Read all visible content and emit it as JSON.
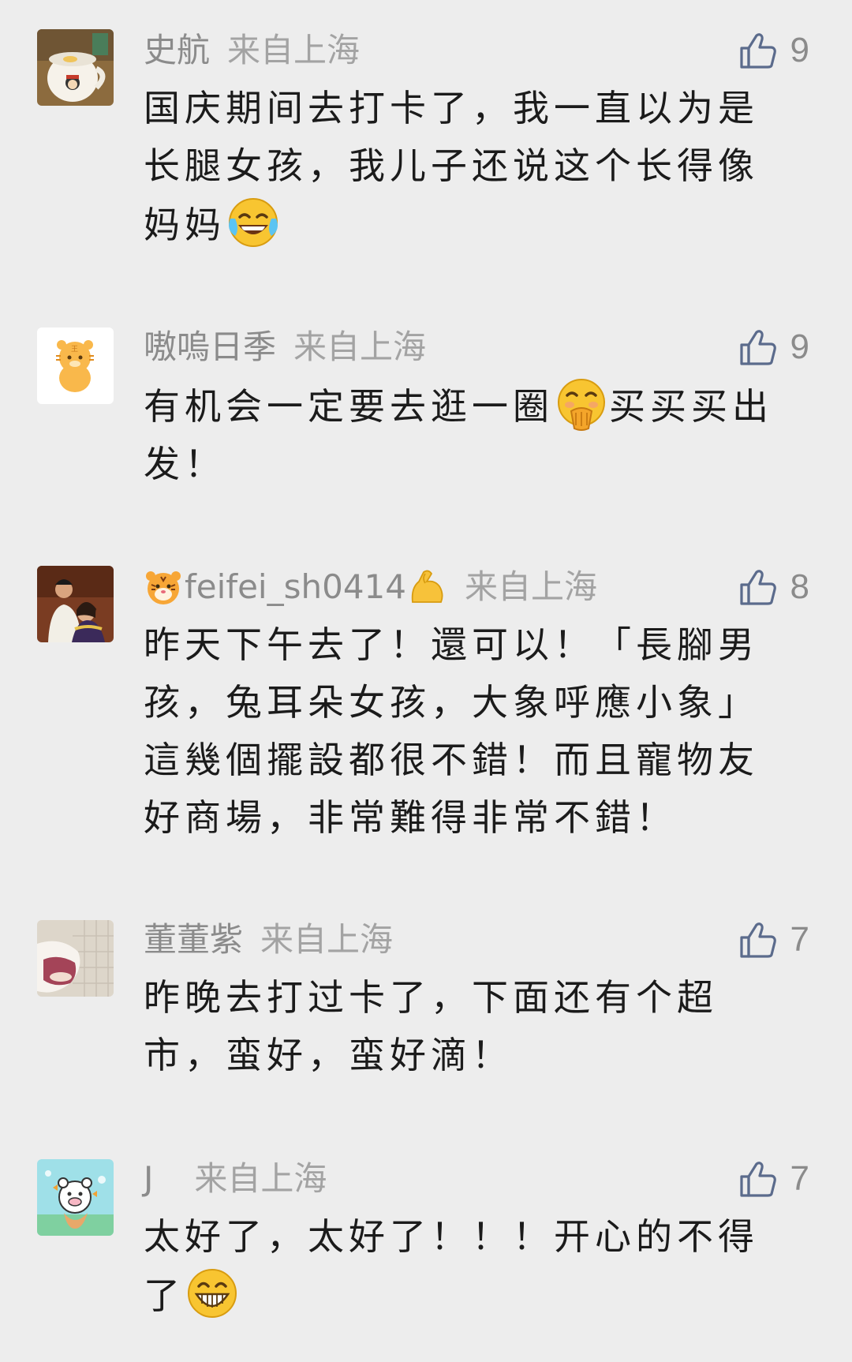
{
  "comments": [
    {
      "nickname": "史航",
      "location": "来自上海",
      "likes": "9",
      "text_before": "国庆期间去打卡了，我一直以为是长腿女孩，我儿子还说这个长得像妈妈",
      "text_after": "",
      "emoji": "tears-of-joy-emoji"
    },
    {
      "nickname": "嗷嗚日季",
      "location": "来自上海",
      "likes": "9",
      "text_before": "有机会一定要去逛一圈",
      "text_after": "买买买出发！",
      "emoji": "hand-over-mouth-emoji"
    },
    {
      "nickname": "feifei_sh0414",
      "location": "来自上海",
      "likes": "8",
      "text_before": "昨天下午去了！還可以！「長腳男孩，兔耳朵女孩，大象呼應小象」這幾個擺設都很不錯！而且寵物友好商場，非常難得非常不錯！",
      "text_after": "",
      "emoji": ""
    },
    {
      "nickname": "董董紫",
      "location": "来自上海",
      "likes": "7",
      "text_before": "昨晚去打过卡了，下面还有个超市，蛮好，蛮好滴！",
      "text_after": "",
      "emoji": ""
    },
    {
      "nickname": "J",
      "location": "来自上海",
      "likes": "7",
      "text_before": "太好了，太好了！！！开心的不得了",
      "text_after": "",
      "emoji": "grinning-emoji"
    }
  ],
  "colors": {
    "background": "#ededed",
    "meta_text": "#8b8b8b",
    "body_text": "#1b1b1b",
    "like_icon": "#5b6b8c"
  }
}
